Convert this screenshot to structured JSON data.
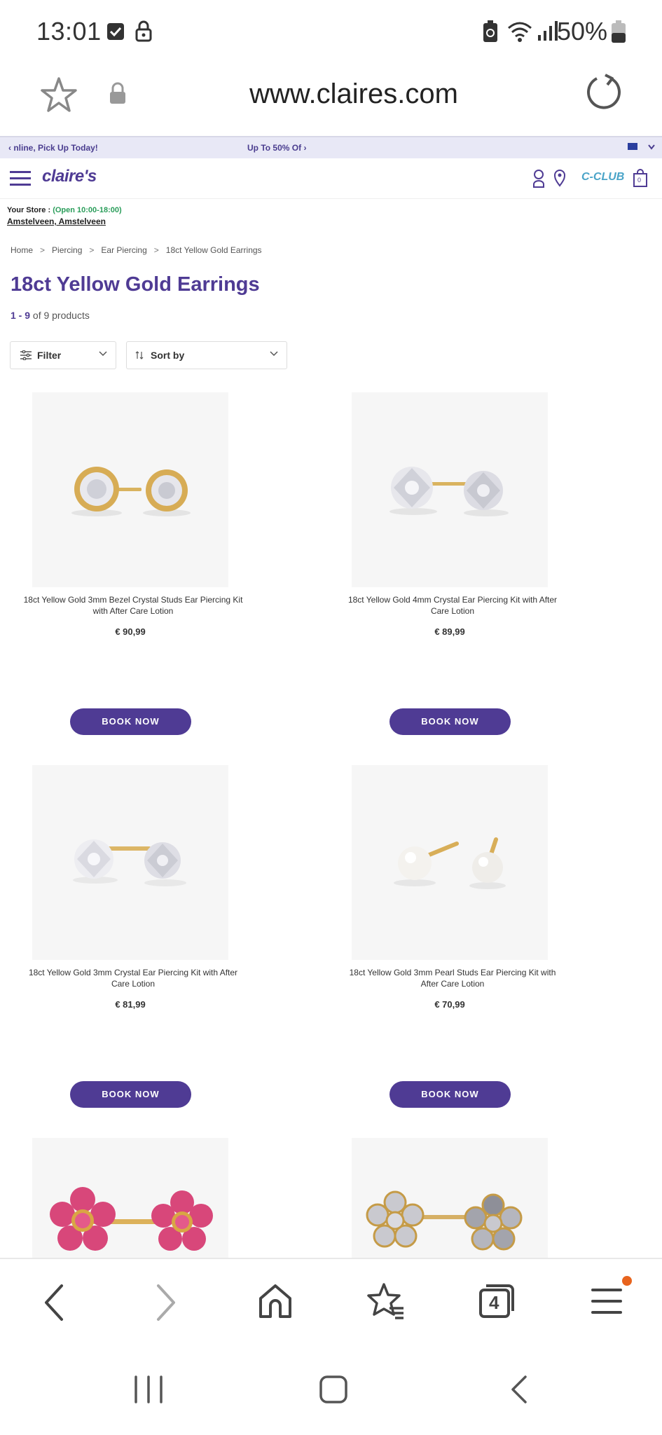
{
  "status_bar": {
    "time": "13:01",
    "battery": "50%"
  },
  "browser": {
    "url": "www.claires.com",
    "tab_count": "4"
  },
  "promo": {
    "left": "‹ nline, Pick Up Today!",
    "center": "Up To 50% Of ›"
  },
  "header": {
    "logo": "claire's",
    "club": "C-CLUB",
    "cart_count": "0"
  },
  "store": {
    "label": "Your Store : ",
    "hours": "(Open 10:00-18:00)",
    "location": "Amstelveen, Amstelveen"
  },
  "breadcrumb": [
    "Home",
    "Piercing",
    "Ear Piercing",
    "18ct Yellow Gold Earrings"
  ],
  "page_title": "18ct Yellow Gold Earrings",
  "count": {
    "range": "1 - 9",
    "of": "of 9 products"
  },
  "controls": {
    "filter": "Filter",
    "sort": "Sort by"
  },
  "products": [
    {
      "name": "18ct Yellow Gold 3mm Bezel Crystal Studs Ear Piercing Kit with After Care Lotion",
      "price": "€ 90,99",
      "button": "BOOK NOW",
      "image": "bezel-crystal-studs"
    },
    {
      "name": "18ct Yellow Gold 4mm Crystal Ear Piercing Kit with After Care Lotion",
      "price": "€ 89,99",
      "button": "BOOK NOW",
      "image": "crystal-studs-4mm"
    },
    {
      "name": "18ct Yellow Gold 3mm Crystal Ear Piercing Kit with After Care Lotion",
      "price": "€ 81,99",
      "button": "BOOK NOW",
      "image": "crystal-studs-3mm"
    },
    {
      "name": "18ct Yellow Gold 3mm Pearl Studs Ear Piercing Kit with After Care Lotion",
      "price": "€ 70,99",
      "button": "BOOK NOW",
      "image": "pearl-studs"
    },
    {
      "image": "pink-flower-studs"
    },
    {
      "image": "crystal-flower-studs"
    }
  ],
  "colors": {
    "brand": "#4f3b94",
    "accent": "#4aa4c8",
    "open": "#2a9d5a",
    "notify": "#e8641e"
  }
}
